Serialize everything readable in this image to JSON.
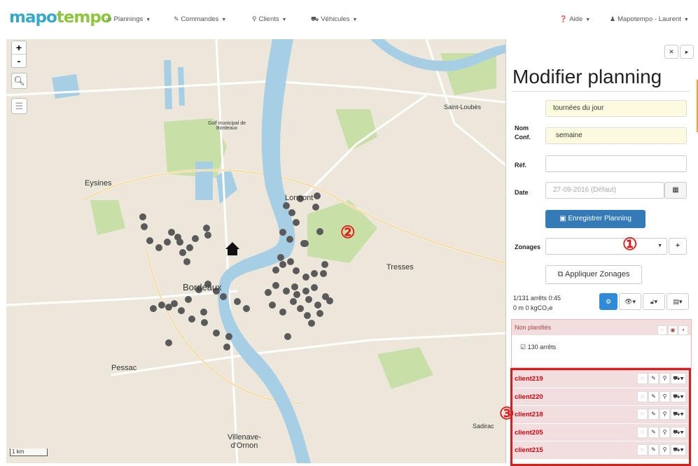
{
  "brand": {
    "part1": "mapo",
    "part2": "tempo"
  },
  "nav": {
    "plannings": "Plannings",
    "commandes": "Commandes",
    "clients": "Clients",
    "vehicules": "Véhicules",
    "aide": "Aide",
    "user": "Mapotempo - Laurent"
  },
  "icons": {
    "plannings": "calendar-icon",
    "commandes": "edit-icon",
    "clients": "map-marker-icon",
    "vehicules": "truck-icon",
    "aide": "question-circle-icon",
    "user": "user-icon"
  },
  "map": {
    "zoom_in": "+",
    "zoom_out": "-",
    "places": [
      "Eysines",
      "Lormont",
      "Bordeaux",
      "Pessac",
      "Tresses",
      "Villenave-d'Ornon",
      "Saint-Loubès",
      "Sadirac",
      "Golf municipal de Bordeaux"
    ],
    "scale": "1 km",
    "callout2": "②"
  },
  "panel": {
    "title": "Modifier planning",
    "nom_label": "Nom",
    "nom_value": "tournées du jour",
    "conf_label": "Conf.",
    "conf_value": "semaine",
    "ref_label": "Réf.",
    "ref_value": "",
    "date_label": "Date",
    "date_placeholder": "27-09-2016 (Défaut)",
    "save_button": "Enregistrer Planning",
    "zonages_label": "Zonages",
    "zonages_value": "",
    "callout1": "①",
    "apply_zonages": "Appliquer Zonages",
    "stats_line1": "1/131 arrêts  0:45",
    "stats_line2": "0 m  0 kgCO₂e",
    "unplanned_title": "Non planifiés",
    "unplanned_count": "130 arrêts",
    "callout3": "③",
    "clients": [
      "client219",
      "client220",
      "client218",
      "client205",
      "client215"
    ]
  },
  "colors": {
    "accent": "#337ab7",
    "water": "#a6cfe6",
    "stops": "#555555",
    "highlight": "#e01a1a",
    "unplanned_bg": "#f2dede"
  }
}
